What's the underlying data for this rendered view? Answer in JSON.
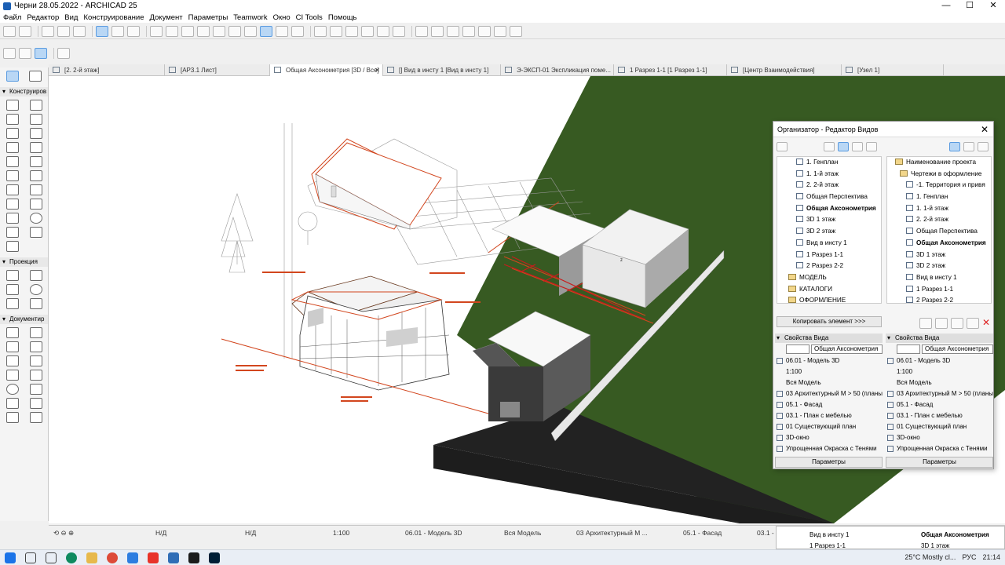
{
  "window": {
    "title": "Черни 28.05.2022 - ARCHICAD 25",
    "min": "—",
    "max": "☐",
    "close": "✕"
  },
  "menu": [
    "Файл",
    "Редактор",
    "Вид",
    "Конструирование",
    "Документ",
    "Параметры",
    "Teamwork",
    "Окно",
    "CI Tools",
    "Помощь"
  ],
  "tabs": [
    {
      "label": "[2. 2-й этаж]",
      "w": 148
    },
    {
      "label": "[АР3.1 Лист]",
      "w": 134
    },
    {
      "label": "Общая Аксонометрия [3D / Все]",
      "w": 144,
      "active": true,
      "close": "✕"
    },
    {
      "label": "[] Вид в инсту 1 [Вид в инсту 1]",
      "w": 150
    },
    {
      "label": "Э-ЭКСП-01 Экспликация поме...",
      "w": 144
    },
    {
      "label": "1 Разрез 1-1 [1 Разрез 1-1]",
      "w": 144
    },
    {
      "label": "[Центр Взаимодействия]",
      "w": 146
    },
    {
      "label": "[Узел 1]",
      "w": 130
    }
  ],
  "palette": {
    "sections": [
      "Конструиров",
      "Проекция",
      "Документир"
    ]
  },
  "organizer": {
    "title": "Организатор - Редактор Видов",
    "close": "✕",
    "left_tree": [
      {
        "label": "1. Генплан",
        "type": "view"
      },
      {
        "label": "1. 1-й этаж",
        "type": "view"
      },
      {
        "label": "2. 2-й этаж",
        "type": "view"
      },
      {
        "label": "Общая Перспектива",
        "type": "view"
      },
      {
        "label": "Общая Аксонометрия",
        "type": "view",
        "bold": true
      },
      {
        "label": "3D 1 этаж",
        "type": "view"
      },
      {
        "label": "3D 2 этаж",
        "type": "view"
      },
      {
        "label": "Вид в инсту 1",
        "type": "view"
      },
      {
        "label": "1 Разрез 1-1",
        "type": "view"
      },
      {
        "label": "2 Разрез 2-2",
        "type": "view"
      },
      {
        "label": "МОДЕЛЬ",
        "type": "folder"
      },
      {
        "label": "КАТАЛОГИ",
        "type": "folder"
      },
      {
        "label": "ОФОРМЛЕНИЕ",
        "type": "folder"
      }
    ],
    "right_tree": [
      {
        "label": "Наименование проекта",
        "type": "root"
      },
      {
        "label": "Чертежи в оформление",
        "type": "folder"
      },
      {
        "label": "-1. Территория и привя",
        "type": "view"
      },
      {
        "label": "1. Генплан",
        "type": "view"
      },
      {
        "label": "1. 1-й этаж",
        "type": "view"
      },
      {
        "label": "2. 2-й этаж",
        "type": "view"
      },
      {
        "label": "Общая Перспектива",
        "type": "view"
      },
      {
        "label": "Общая Аксонометрия",
        "type": "view",
        "bold": true
      },
      {
        "label": "3D 1 этаж",
        "type": "view"
      },
      {
        "label": "3D 2 этаж",
        "type": "view"
      },
      {
        "label": "Вид в инсту 1",
        "type": "view"
      },
      {
        "label": "1 Разрез 1-1",
        "type": "view"
      },
      {
        "label": "2 Разрез 2-2",
        "type": "view"
      }
    ],
    "copy_button": "Копировать элемент >>>",
    "props_header": "Свойства Вида",
    "view_name": "Общая Аксонометрия",
    "props": [
      "06.01 - Модель 3D",
      "1:100",
      "Вся Модель",
      "03 Архитектурный М > 50 (планы)",
      "05.1 - Фасад",
      "03.1 - План с мебелью",
      "01 Существующий план",
      "3D-окно",
      "Упрощенная Окраска с Тенями"
    ],
    "params_button": "Параметры"
  },
  "status": {
    "nd1": "Н/Д",
    "nd2": "Н/Д",
    "scale": "1:100",
    "model": "06.01 - Модель 3D",
    "layers": "Вся Модель",
    "pen": "03 Архитектурный М ...",
    "facade": "05.1 - Фасад",
    "plan": "03.1 -"
  },
  "mini": {
    "a": "Вид в инсту 1",
    "b": "1 Разрез 1-1",
    "c": "Общая Аксонометрия",
    "d": "3D 1 этаж"
  },
  "taskbar": {
    "weather": "25°C  Mostly cl...",
    "lang": "РУС",
    "time": "21:14"
  },
  "canvas_labels": {
    "z": "z"
  }
}
